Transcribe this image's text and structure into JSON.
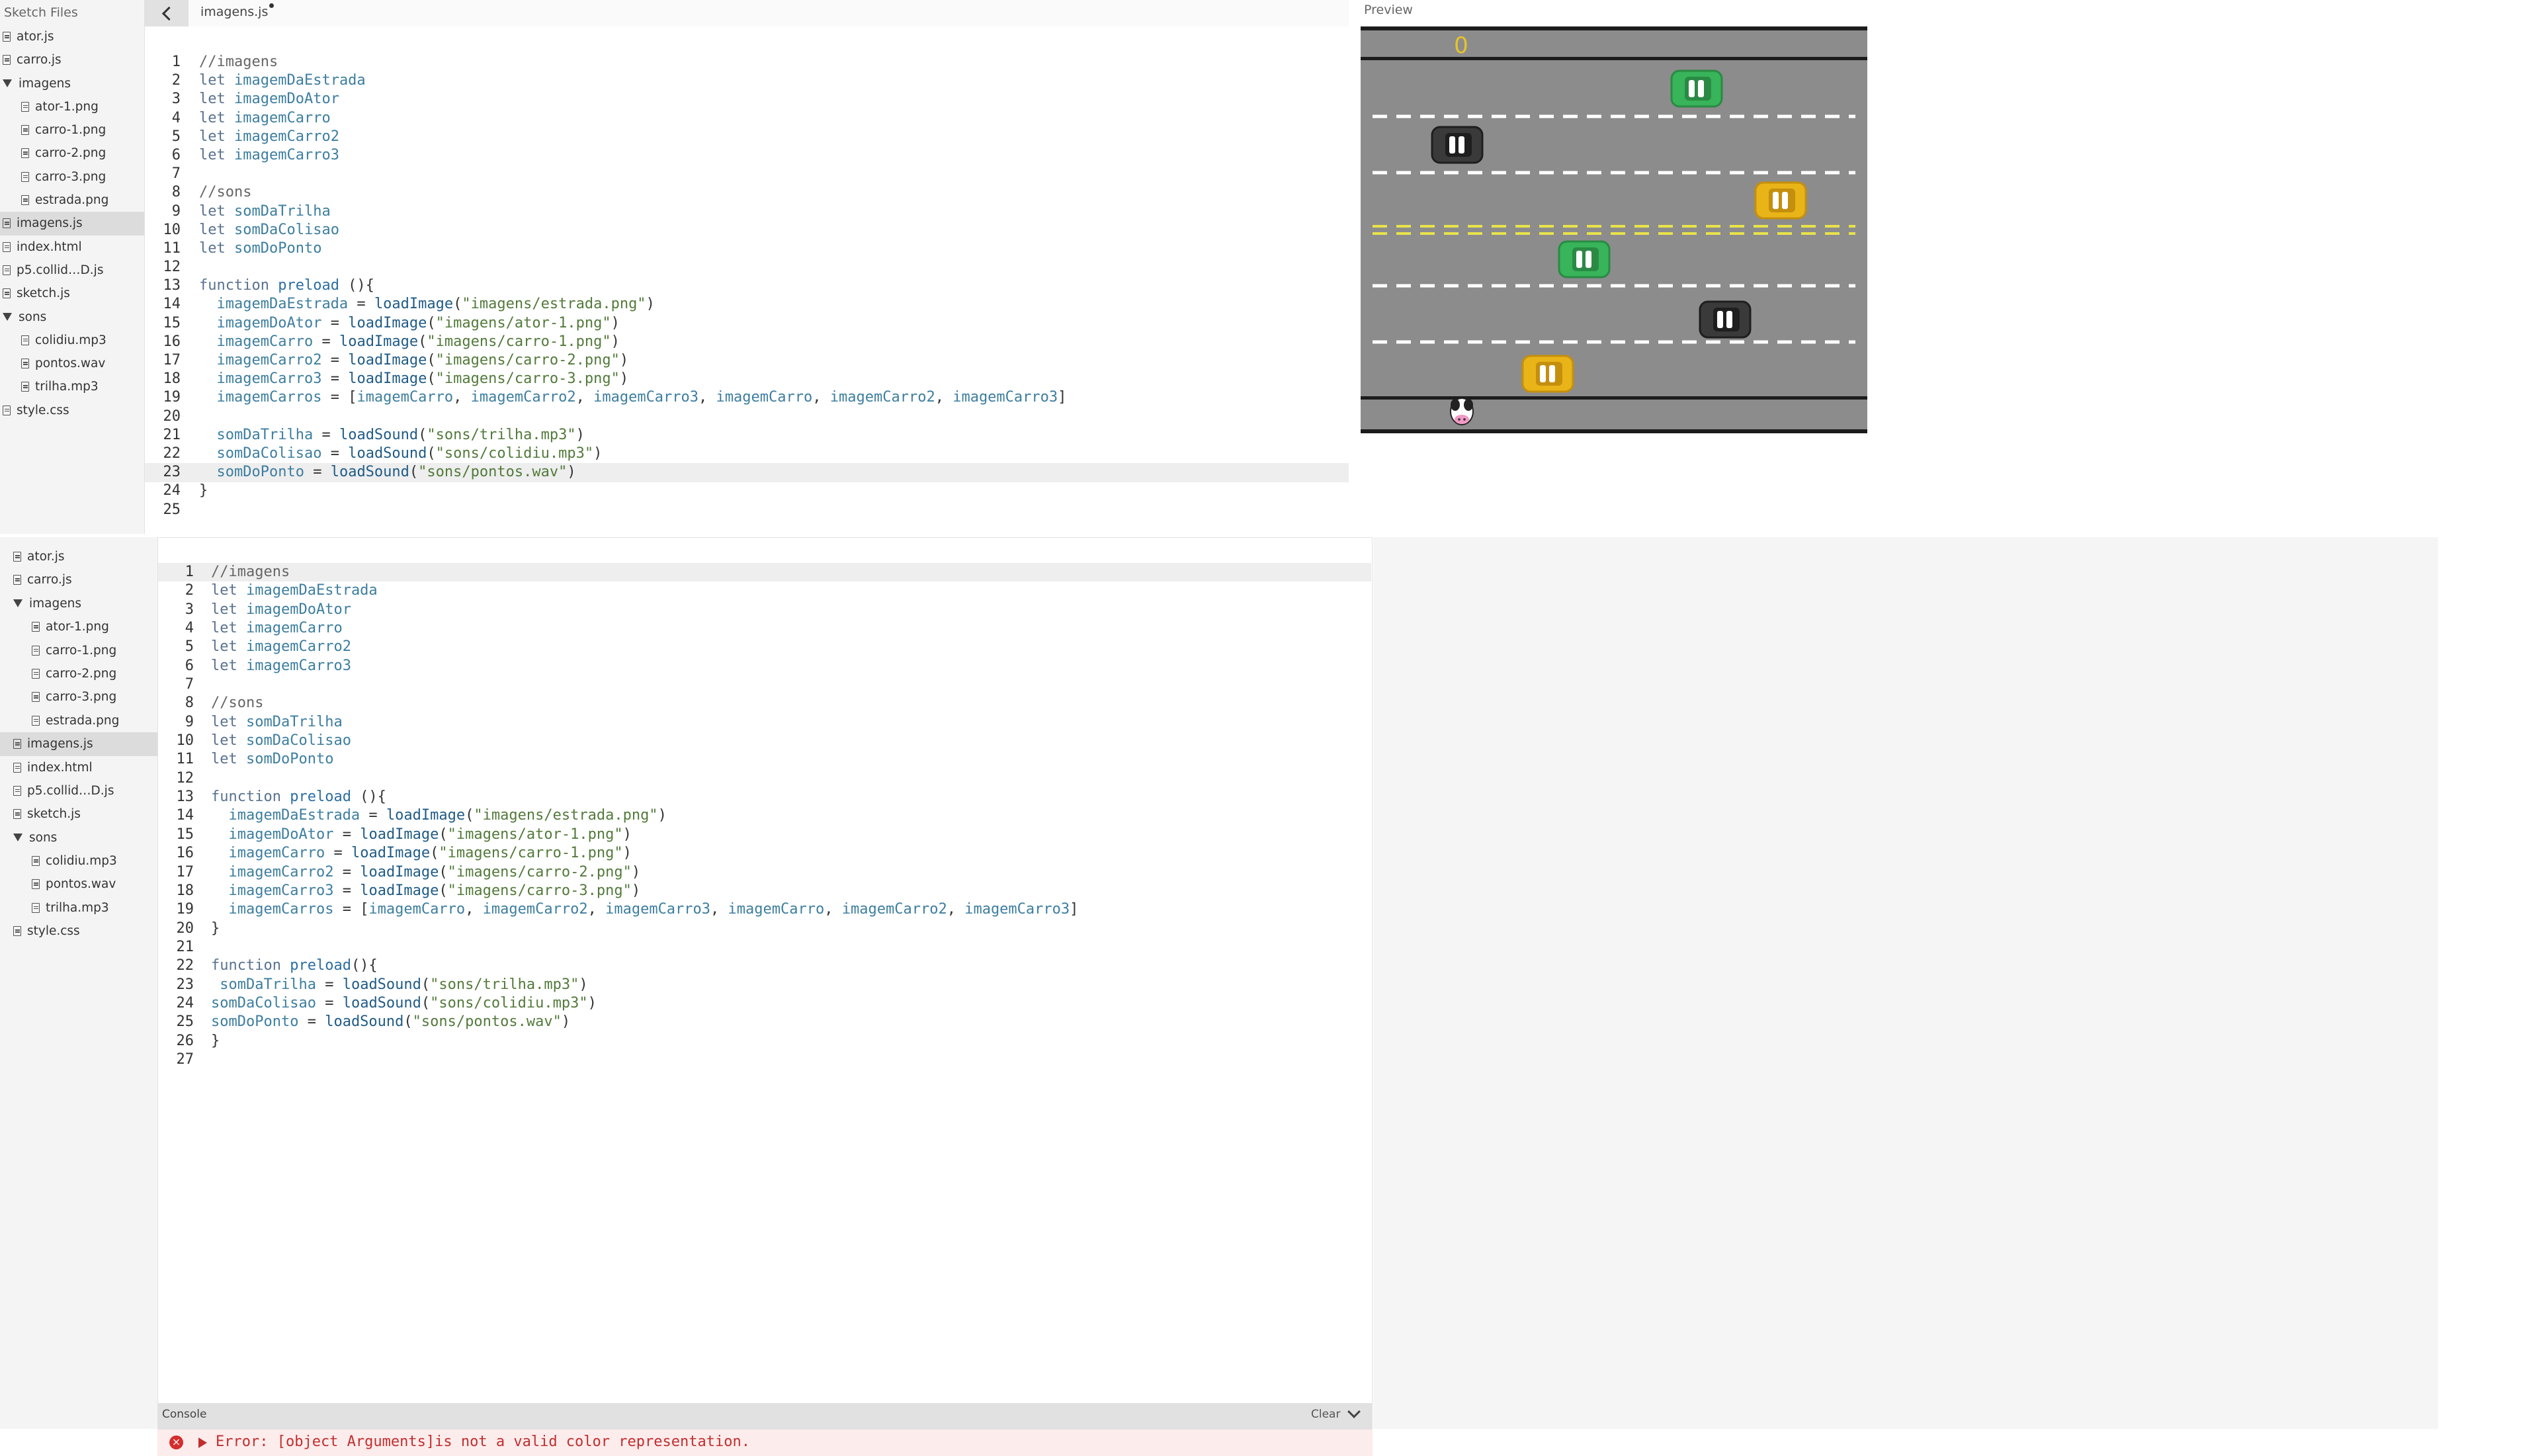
{
  "top_sidebar": {
    "header": "Sketch Files",
    "items": [
      {
        "label": "ator.js",
        "type": "file",
        "depth": 0
      },
      {
        "label": "carro.js",
        "type": "file",
        "depth": 0
      },
      {
        "label": "imagens",
        "type": "folder",
        "depth": 0
      },
      {
        "label": "ator-1.png",
        "type": "file",
        "depth": 1
      },
      {
        "label": "carro-1.png",
        "type": "file",
        "depth": 1
      },
      {
        "label": "carro-2.png",
        "type": "file",
        "depth": 1
      },
      {
        "label": "carro-3.png",
        "type": "file",
        "depth": 1
      },
      {
        "label": "estrada.png",
        "type": "file",
        "depth": 1
      },
      {
        "label": "imagens.js",
        "type": "file",
        "depth": 0,
        "active": true
      },
      {
        "label": "index.html",
        "type": "file",
        "depth": 0
      },
      {
        "label": "p5.collid…D.js",
        "type": "file",
        "depth": 0
      },
      {
        "label": "sketch.js",
        "type": "file",
        "depth": 0
      },
      {
        "label": "sons",
        "type": "folder",
        "depth": 0
      },
      {
        "label": "colidiu.mp3",
        "type": "file",
        "depth": 1
      },
      {
        "label": "pontos.wav",
        "type": "file",
        "depth": 1
      },
      {
        "label": "trilha.mp3",
        "type": "file",
        "depth": 1
      },
      {
        "label": "style.css",
        "type": "file",
        "depth": 0
      }
    ]
  },
  "top_tab": {
    "filename": "imagens.js",
    "unsaved": true
  },
  "top_editor": {
    "highlight_line": 23,
    "lines": [
      "//imagens",
      "let imagemDaEstrada",
      "let imagemDoAtor",
      "let imagemCarro",
      "let imagemCarro2",
      "let imagemCarro3",
      "",
      "//sons",
      "let somDaTrilha",
      "let somDaColisao",
      "let somDoPonto",
      "",
      "function preload (){",
      "  imagemDaEstrada = loadImage(\"imagens/estrada.png\")",
      "  imagemDoAtor = loadImage(\"imagens/ator-1.png\")",
      "  imagemCarro = loadImage(\"imagens/carro-1.png\")",
      "  imagemCarro2 = loadImage(\"imagens/carro-2.png\")",
      "  imagemCarro3 = loadImage(\"imagens/carro-3.png\")",
      "  imagemCarros = [imagemCarro, imagemCarro2, imagemCarro3, imagemCarro, imagemCarro2, imagemCarro3]",
      "",
      "  somDaTrilha = loadSound(\"sons/trilha.mp3\")",
      "  somDaColisao = loadSound(\"sons/colidiu.mp3\")",
      "  somDoPonto = loadSound(\"sons/pontos.wav\")",
      "}",
      ""
    ]
  },
  "preview": {
    "label": "Preview",
    "score": "0",
    "colors": {
      "road": "#8c8c8c",
      "lane": "#ffffff",
      "center": "#e8e24a",
      "edge": "#1c1c1c",
      "score": "#e5c42a"
    },
    "cars": [
      {
        "color": "green",
        "lane": 1
      },
      {
        "color": "black",
        "lane": 2
      },
      {
        "color": "yellow",
        "lane": 3
      },
      {
        "color": "green",
        "lane": 4
      },
      {
        "color": "black",
        "lane": 5
      },
      {
        "color": "yellow",
        "lane": 6
      }
    ],
    "actor": "cow"
  },
  "bottom_sidebar": {
    "items": [
      {
        "label": "ator.js",
        "type": "file",
        "depth": 0
      },
      {
        "label": "carro.js",
        "type": "file",
        "depth": 0
      },
      {
        "label": "imagens",
        "type": "folder",
        "depth": 0
      },
      {
        "label": "ator-1.png",
        "type": "file",
        "depth": 1
      },
      {
        "label": "carro-1.png",
        "type": "file",
        "depth": 1
      },
      {
        "label": "carro-2.png",
        "type": "file",
        "depth": 1
      },
      {
        "label": "carro-3.png",
        "type": "file",
        "depth": 1
      },
      {
        "label": "estrada.png",
        "type": "file",
        "depth": 1
      },
      {
        "label": "imagens.js",
        "type": "file",
        "depth": 0,
        "active": true
      },
      {
        "label": "index.html",
        "type": "file",
        "depth": 0
      },
      {
        "label": "p5.collid…D.js",
        "type": "file",
        "depth": 0
      },
      {
        "label": "sketch.js",
        "type": "file",
        "depth": 0
      },
      {
        "label": "sons",
        "type": "folder",
        "depth": 0
      },
      {
        "label": "colidiu.mp3",
        "type": "file",
        "depth": 1
      },
      {
        "label": "pontos.wav",
        "type": "file",
        "depth": 1
      },
      {
        "label": "trilha.mp3",
        "type": "file",
        "depth": 1
      },
      {
        "label": "style.css",
        "type": "file",
        "depth": 0
      }
    ]
  },
  "bottom_editor": {
    "highlight_line": 1,
    "lines": [
      "//imagens",
      "let imagemDaEstrada",
      "let imagemDoAtor",
      "let imagemCarro",
      "let imagemCarro2",
      "let imagemCarro3",
      "",
      "//sons",
      "let somDaTrilha",
      "let somDaColisao",
      "let somDoPonto",
      "",
      "function preload (){",
      "  imagemDaEstrada = loadImage(\"imagens/estrada.png\")",
      "  imagemDoAtor = loadImage(\"imagens/ator-1.png\")",
      "  imagemCarro = loadImage(\"imagens/carro-1.png\")",
      "  imagemCarro2 = loadImage(\"imagens/carro-2.png\")",
      "  imagemCarro3 = loadImage(\"imagens/carro-3.png\")",
      "  imagemCarros = [imagemCarro, imagemCarro2, imagemCarro3, imagemCarro, imagemCarro2, imagemCarro3]",
      "}",
      "",
      "function preload(){",
      " somDaTrilha = loadSound(\"sons/trilha.mp3\")",
      "somDaColisao = loadSound(\"sons/colidiu.mp3\")",
      "somDoPonto = loadSound(\"sons/pontos.wav\")",
      "}",
      ""
    ]
  },
  "console": {
    "title": "Console",
    "clear_label": "Clear",
    "error_icon": "×",
    "error_message": "Error: [object Arguments]is not a valid color representation."
  }
}
